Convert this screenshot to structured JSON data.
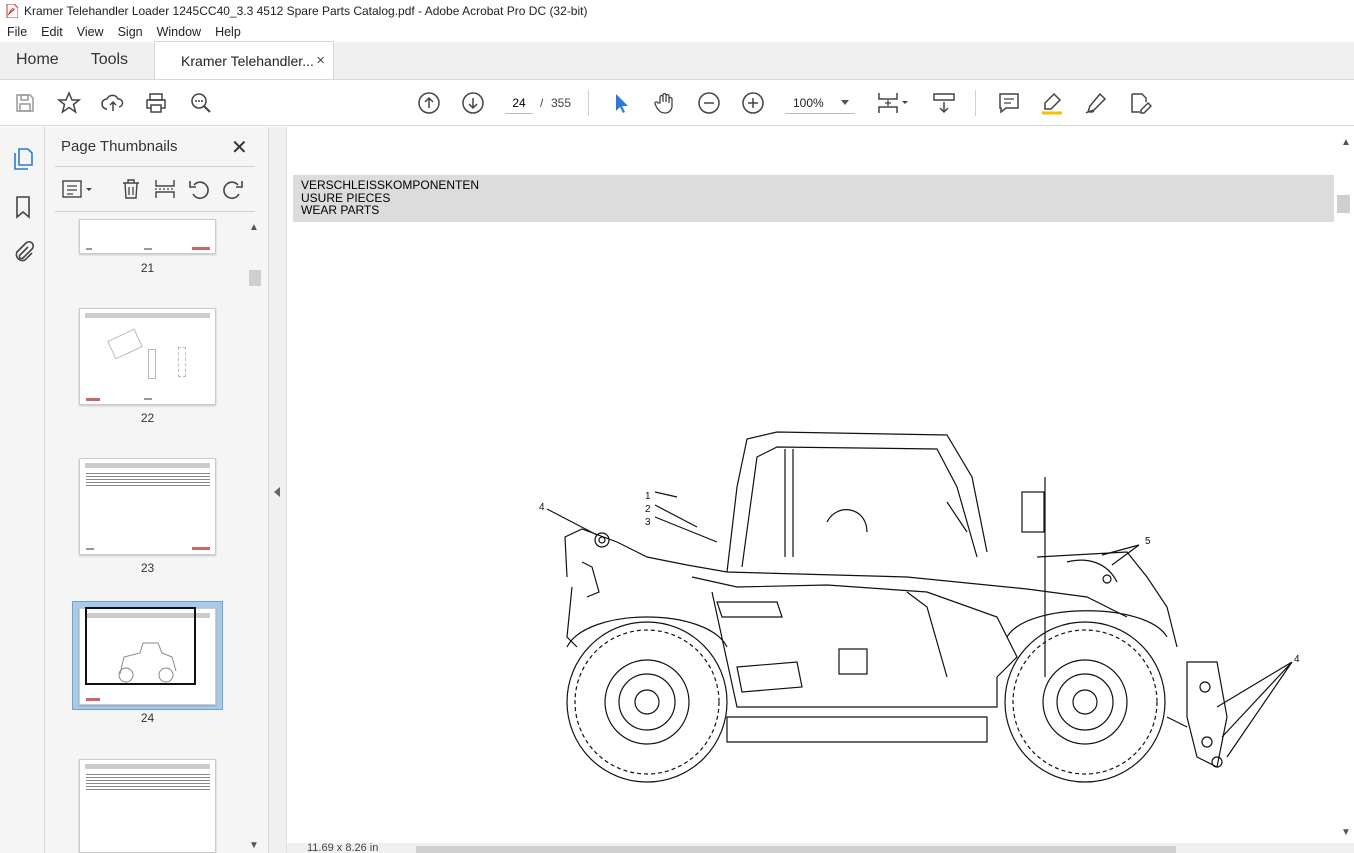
{
  "window": {
    "title": "Kramer Telehandler Loader 1245CC40_3.3 4512 Spare Parts Catalog.pdf - Adobe Acrobat Pro DC (32-bit)"
  },
  "menu": [
    "File",
    "Edit",
    "View",
    "Sign",
    "Window",
    "Help"
  ],
  "tabs": {
    "home": "Home",
    "tools": "Tools",
    "document": "Kramer Telehandler...",
    "close": "×"
  },
  "toolbar": {
    "page_current": "24",
    "page_separator": "/",
    "page_total": "355",
    "zoom": "100%",
    "icons": [
      "save-icon",
      "star-icon",
      "upload-icon",
      "print-icon",
      "zoom-search-icon",
      "page-up-icon",
      "page-down-icon",
      "select-arrow-icon",
      "hand-icon",
      "zoom-out-icon",
      "zoom-in-icon",
      "page-fit-icon",
      "scroll-mode-icon",
      "comment-icon",
      "highlight-icon",
      "sign-icon",
      "edit-pdf-icon"
    ]
  },
  "panel": {
    "title": "Page Thumbnails",
    "close": "✕",
    "thumbnails": [
      {
        "label": "21"
      },
      {
        "label": "22"
      },
      {
        "label": "23"
      },
      {
        "label": "24",
        "selected": true
      },
      {
        "label": ""
      }
    ]
  },
  "document": {
    "header_lines": [
      "VERSCHLEISSKOMPONENTEN",
      "USURE PIECES",
      "WEAR PARTS"
    ],
    "callouts": [
      "1",
      "2",
      "3",
      "4",
      "4",
      "5"
    ]
  },
  "status": {
    "page_size": "11.69 x 8.26 in"
  },
  "colors": {
    "accent": "#2a7bd3",
    "selection": "#a9cbe8",
    "header_band": "#dcdcdc",
    "app_red": "#d32f2f"
  }
}
